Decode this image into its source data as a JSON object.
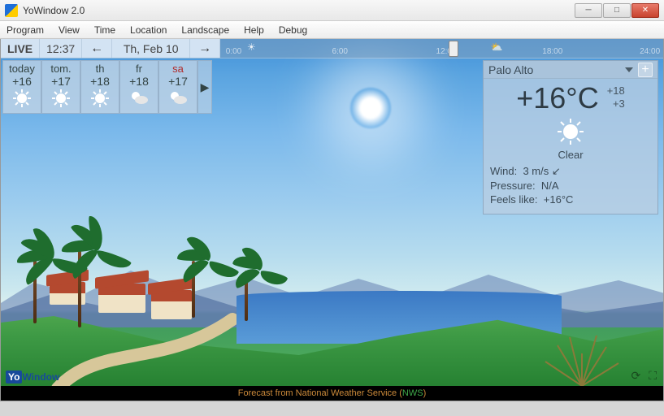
{
  "window": {
    "title": "YoWindow 2.0"
  },
  "menu": [
    "Program",
    "View",
    "Time",
    "Location",
    "Landscape",
    "Help",
    "Debug"
  ],
  "timeline": {
    "live_label": "LIVE",
    "clock": "12:37",
    "date": "Th, Feb 10",
    "ticks": [
      "0:00",
      "6:00",
      "12:00",
      "18:00",
      "24:00"
    ],
    "cursor_pct": 51.5,
    "sky_icons": [
      {
        "name": "sun-icon",
        "pct": 7
      },
      {
        "name": "partly-cloudy-icon",
        "pct": 62
      }
    ]
  },
  "forecast": [
    {
      "label": "today",
      "temp": "+16",
      "icon": "sun-icon",
      "weekend": false
    },
    {
      "label": "tom.",
      "temp": "+17",
      "icon": "sun-icon",
      "weekend": false
    },
    {
      "label": "th",
      "temp": "+18",
      "icon": "sun-icon",
      "weekend": false
    },
    {
      "label": "fr",
      "temp": "+18",
      "icon": "partly-cloudy-icon",
      "weekend": false
    },
    {
      "label": "sa",
      "temp": "+17",
      "icon": "partly-cloudy-icon",
      "weekend": true
    }
  ],
  "details": {
    "location": "Palo Alto",
    "temp": "+16°C",
    "high": "+18",
    "low": "+3",
    "condition_icon": "sun-icon",
    "condition_text": "Clear",
    "wind_label": "Wind:",
    "wind_value": "3 m/s",
    "wind_dir_icon": "arrow-down-left-icon",
    "pressure_label": "Pressure:",
    "pressure_value": "N/A",
    "feels_label": "Feels like:",
    "feels_value": "+16°C"
  },
  "footer": {
    "prefix": "Forecast from National Weather Service (",
    "src": "NWS",
    "suffix": ")"
  },
  "brand": {
    "yo": "Yo",
    "win": "Window"
  }
}
